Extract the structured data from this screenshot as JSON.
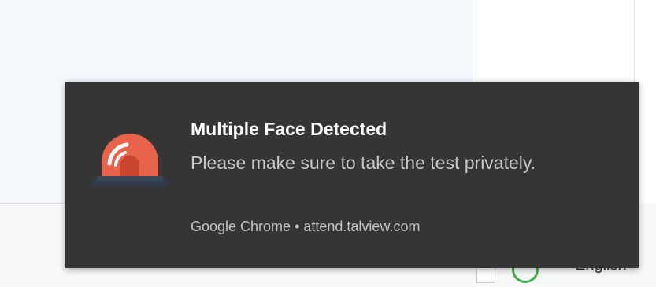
{
  "notification": {
    "title": "Multiple Face Detected",
    "message": "Please make sure to take the test privately.",
    "source": "Google Chrome • attend.talview.com",
    "icon": "siren-alarm-icon",
    "colors": {
      "background": "#353535",
      "icon_dome": "#e8634a",
      "icon_base": "#2f3a4a",
      "title": "#ffffff",
      "body_text": "#c8c8c8"
    }
  },
  "background_page": {
    "language_label": "English",
    "language_icon": "globe-icon"
  }
}
